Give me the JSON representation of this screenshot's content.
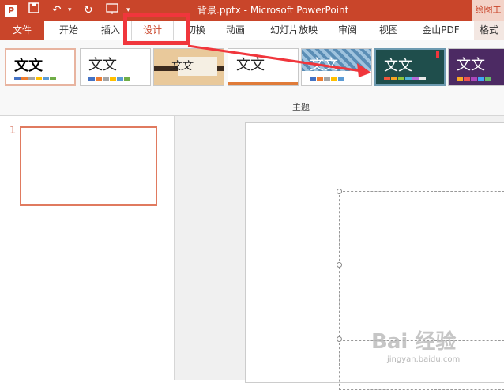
{
  "window": {
    "title": "背景.pptx - Microsoft PowerPoint",
    "context_tab": "绘图工"
  },
  "quick_access": {
    "app_icon": "P"
  },
  "tabs": [
    {
      "label": "文件"
    },
    {
      "label": "开始"
    },
    {
      "label": "插入"
    },
    {
      "label": "设计"
    },
    {
      "label": "切换"
    },
    {
      "label": "动画"
    },
    {
      "label": "幻灯片放映"
    },
    {
      "label": "审阅"
    },
    {
      "label": "视图"
    },
    {
      "label": "金山PDF"
    },
    {
      "label": "格式"
    }
  ],
  "themes": {
    "group_label": "主题",
    "items": [
      {
        "label": "文文"
      },
      {
        "label": "文文"
      },
      {
        "label": "文文"
      },
      {
        "label": "文文"
      },
      {
        "label": "文文"
      },
      {
        "label": "文文"
      },
      {
        "label": "文文"
      }
    ]
  },
  "slides": {
    "items": [
      {
        "number": "1"
      }
    ]
  },
  "watermark": {
    "text": "Bai 经验",
    "sub": "jingyan.baidu.com"
  },
  "colors": {
    "accent": "#c9452a",
    "highlight": "#f0363c"
  }
}
